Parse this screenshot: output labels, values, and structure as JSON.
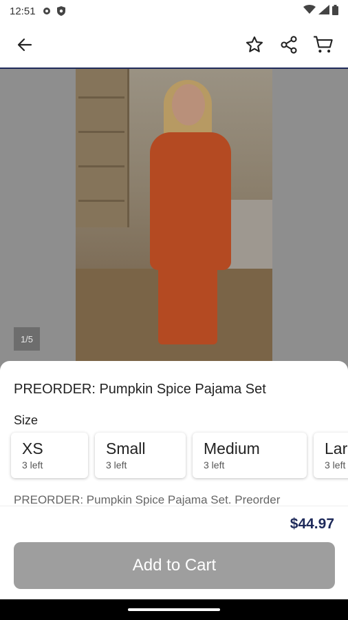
{
  "status_bar": {
    "time": "12:51",
    "left_icons": [
      "gear-icon",
      "shield-icon"
    ],
    "right_icons": [
      "wifi-icon",
      "signal-icon",
      "battery-icon"
    ]
  },
  "topbar": {
    "back_icon": "arrow-left-icon",
    "actions": [
      "star-icon",
      "share-icon",
      "cart-icon"
    ]
  },
  "gallery": {
    "counter": "1/5"
  },
  "product": {
    "title": "PREORDER: Pumpkin Spice Pajama Set",
    "size_label": "Size",
    "sizes": [
      {
        "name": "XS",
        "stock": "3 left"
      },
      {
        "name": "Small",
        "stock": "3 left"
      },
      {
        "name": "Medium",
        "stock": "3 left"
      },
      {
        "name": "Large",
        "stock": "3 left"
      }
    ],
    "description": "PREORDER: Pumpkin Spice Pajama Set. Preorder"
  },
  "footer": {
    "price": "$44.97",
    "add_to_cart": "Add to Cart"
  },
  "colors": {
    "brand_navy": "#1e2a5a",
    "button_disabled": "#9e9e9e"
  }
}
